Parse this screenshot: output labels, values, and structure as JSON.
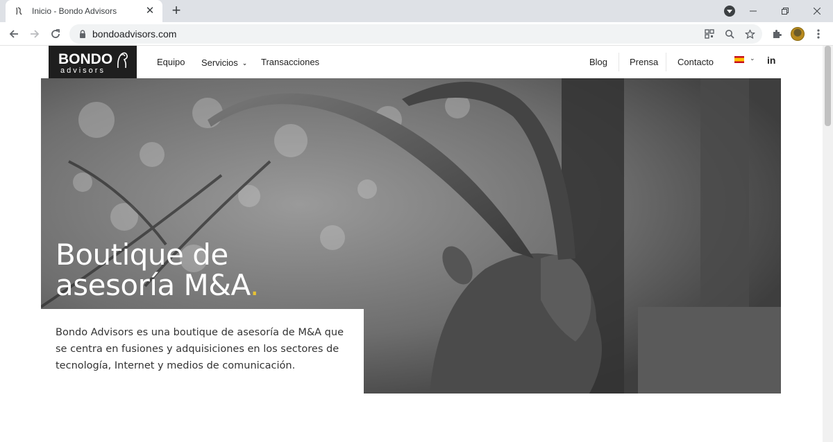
{
  "browser": {
    "tab_title": "Inicio - Bondo Advisors",
    "url": "bondoadvisors.com"
  },
  "site": {
    "logo": {
      "top": "BONDO",
      "bottom": "advisors"
    },
    "nav_left": [
      {
        "label": "Equipo"
      },
      {
        "label": "Servicios"
      },
      {
        "label": "Transacciones"
      }
    ],
    "nav_right": [
      {
        "label": "Blog"
      },
      {
        "label": "Prensa"
      },
      {
        "label": "Contacto"
      }
    ],
    "language_flag": "es",
    "social": "in"
  },
  "hero": {
    "title_line1": "Boutique de",
    "title_line2": "asesoría M&A",
    "title_dot": ".",
    "accent_color": "#e7c234",
    "intro": "Bondo Advisors es una boutique de asesoría de M&A que se centra en fusiones y adquisiciones en los sectores de tecnología, Internet y medios de comunicación."
  }
}
